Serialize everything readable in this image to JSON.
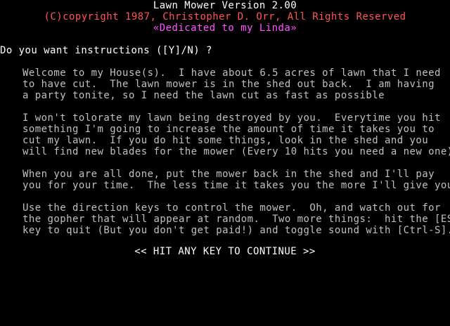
{
  "header": {
    "title": "Lawn Mower Version 2.00",
    "copyright": "(C)copyright 1987, Christopher D. Orr, All Rights Reserved",
    "dedication": "«Dedicated to my Linda»"
  },
  "prompt": {
    "question": "Do you want instructions ([Y]/N) ?"
  },
  "instructions": {
    "p1": [
      "Welcome to my House(s).  I have about 6.5 acres of lawn that I need",
      "to have cut.  The lawn mower is in the shed out back.  I am having",
      "a party tonite, so I need the lawn cut as fast as possible"
    ],
    "p2": [
      "I won't tolorate my lawn being destroyed by you.  Everytime you hit",
      "something I'm going to increase the amount of time it takes you to",
      "cut my lawn.  If you do hit some things, look in the shed and you",
      "will find new blades for the mower (Every 10 hits you need a new one)."
    ],
    "p3": [
      "When you are all done, put the mower back in the shed and I'll pay",
      "you for your time.  The less time it takes you the more I'll give you."
    ],
    "p4": [
      "Use the direction keys to control the mower.  Oh, and watch out for",
      "the gopher that will appear at random.  Two more things:  hit the [ESC]",
      "key to quit (But you don't get paid!) and toggle sound with [Ctrl-S]."
    ]
  },
  "footer": {
    "continue_prompt": "<< HIT ANY KEY TO CONTINUE >>"
  },
  "colors": {
    "background": "#000000",
    "title": "#ffffff",
    "copyright": "#ff5555",
    "dedication": "#ff55ff",
    "question": "#ffffff",
    "body": "#c0c0c0",
    "continue": "#ffffff"
  }
}
